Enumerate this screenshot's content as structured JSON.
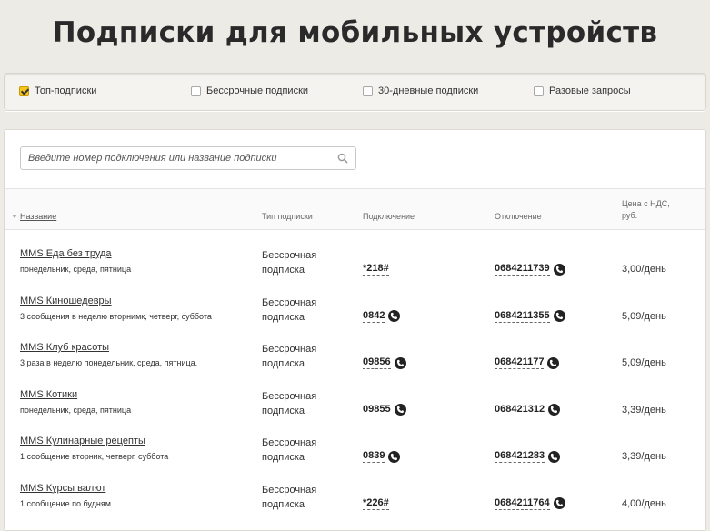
{
  "page": {
    "title": "Подписки для мобильных устройств"
  },
  "filters": [
    {
      "label": "Топ-подписки",
      "checked": true
    },
    {
      "label": "Бессрочные подписки",
      "checked": false
    },
    {
      "label": "30-дневные подписки",
      "checked": false
    },
    {
      "label": "Разовые запросы",
      "checked": false
    }
  ],
  "search": {
    "placeholder": "Введите номер подключения или название подписки",
    "icon": "search-icon"
  },
  "table": {
    "headers": {
      "name": "Название",
      "type": "Тип подписки",
      "connect": "Подключение",
      "disconnect": "Отключение",
      "price_line1": "Цена с НДС,",
      "price_line2": "руб."
    },
    "rows": [
      {
        "name": "MMS Еда без труда",
        "desc": "понедельник, среда, пятница",
        "type1": "Бессрочная",
        "type2": "подписка",
        "connect": "*218#",
        "connect_phone": false,
        "disconnect": "0684211739",
        "price": "3,00/день"
      },
      {
        "name": "MMS Киношедевры",
        "desc": "3 сообщения в неделю вторнимк, четверг, суббота",
        "type1": "Бессрочная",
        "type2": "подписка",
        "connect": "0842",
        "connect_phone": true,
        "disconnect": "0684211355",
        "price": "5,09/день"
      },
      {
        "name": "MMS Клуб красоты",
        "desc": "3 раза в неделю понедельник, среда, пятница.",
        "type1": "Бессрочная",
        "type2": "подписка",
        "connect": "09856",
        "connect_phone": true,
        "disconnect": "068421177",
        "price": "5,09/день"
      },
      {
        "name": "MMS Котики",
        "desc": "понедельник, среда, пятница",
        "type1": "Бессрочная",
        "type2": "подписка",
        "connect": "09855",
        "connect_phone": true,
        "disconnect": "068421312",
        "price": "3,39/день"
      },
      {
        "name": "MMS Кулинарные рецепты",
        "desc": "1 сообщение вторник, четверг, суббота",
        "type1": "Бессрочная",
        "type2": "подписка",
        "connect": "0839",
        "connect_phone": true,
        "disconnect": "068421283",
        "price": "3,39/день"
      },
      {
        "name": "MMS Курсы валют",
        "desc": "1 сообщение по будням",
        "type1": "Бессрочная",
        "type2": "подписка",
        "connect": "*226#",
        "connect_phone": false,
        "disconnect": "0684211764",
        "price": "4,00/день"
      }
    ]
  }
}
